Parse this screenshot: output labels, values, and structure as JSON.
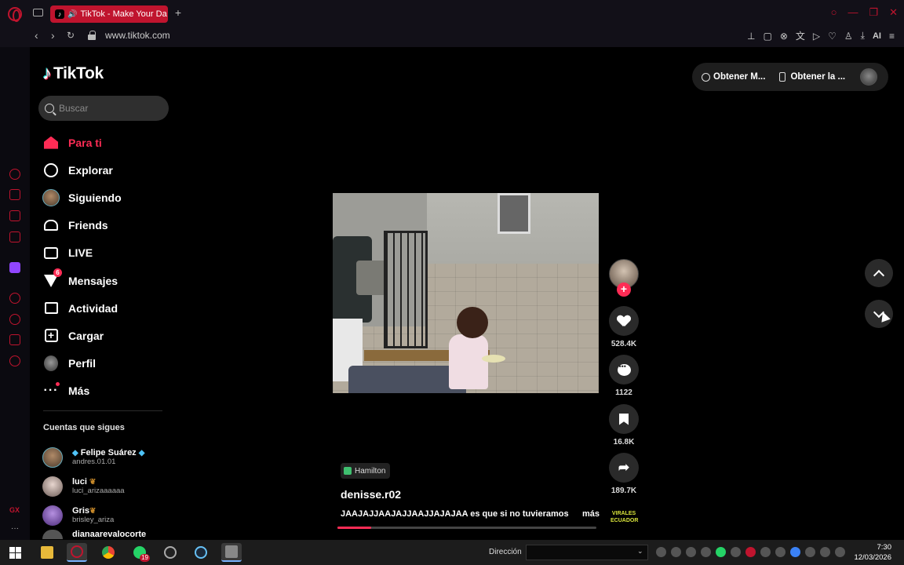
{
  "browser": {
    "tab_title": "TikTok - Make Your Da",
    "url": "www.tiktok.com",
    "ai_label": "AI"
  },
  "tiktok": {
    "logo_text": "TikTok",
    "search_placeholder": "Buscar",
    "nav": [
      {
        "label": "Para ti",
        "icon": "home-icon",
        "active": true
      },
      {
        "label": "Explorar",
        "icon": "compass-icon"
      },
      {
        "label": "Siguiendo",
        "icon": "avatar-icon"
      },
      {
        "label": "Friends",
        "icon": "friends-icon"
      },
      {
        "label": "LIVE",
        "icon": "live-icon"
      },
      {
        "label": "Mensajes",
        "icon": "messages-icon",
        "badge": "6"
      },
      {
        "label": "Actividad",
        "icon": "activity-icon"
      },
      {
        "label": "Cargar",
        "icon": "upload-icon"
      },
      {
        "label": "Perfil",
        "icon": "profile-icon"
      },
      {
        "label": "Más",
        "icon": "more-icon"
      }
    ],
    "following_title": "Cuentas que sigues",
    "following": [
      {
        "name": "Felipe Suárez",
        "username": "andres.01.01"
      },
      {
        "name": "luci",
        "username": "luci_arizaaaaaa"
      },
      {
        "name": "Gris",
        "username": "brisley_ariza"
      },
      {
        "name": "dianaarevalocorte",
        "username": ""
      }
    ],
    "top_links": {
      "coins": "Obtener M...",
      "app": "Obtener la ..."
    },
    "video": {
      "likes": "528.4K",
      "comments": "1122",
      "saves": "16.8K",
      "shares": "189.7K",
      "effect": "Hamilton",
      "author": "denisse.r02",
      "caption": "JAAJAJJAAJAJJAAJJAJAJAA es que si no tuvieramos",
      "more": "más",
      "music_badge": "VIRALES ECUADOR",
      "progress": 0.13
    }
  },
  "taskbar": {
    "address_label": "Dirección",
    "whatsapp_badge": "19",
    "time": "7:30",
    "date": "12/03/2026"
  }
}
